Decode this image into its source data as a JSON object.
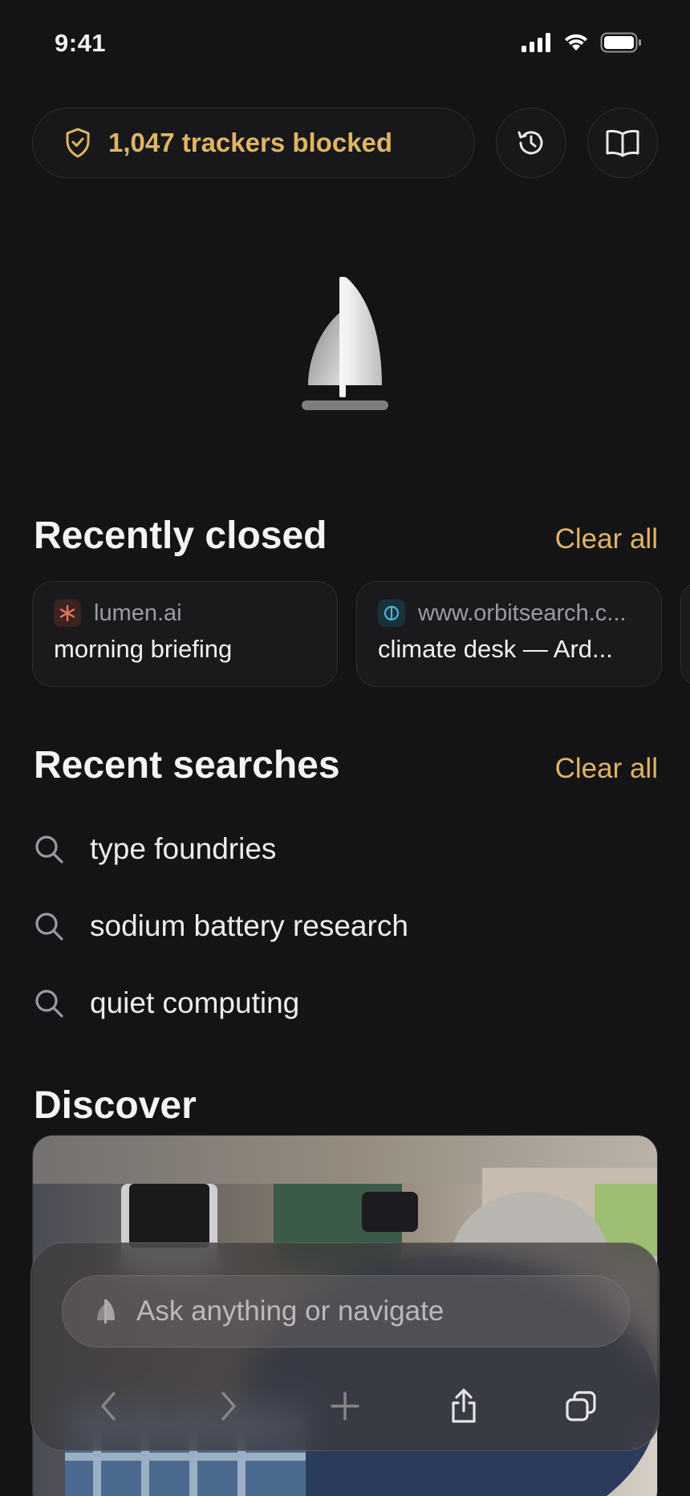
{
  "status": {
    "time": "9:41"
  },
  "header": {
    "trackers_label": "1,047 trackers blocked",
    "history_icon": "history-icon",
    "reader_icon": "book-icon"
  },
  "recently_closed": {
    "title": "Recently closed",
    "clear_label": "Clear all",
    "tabs": [
      {
        "site": "lumen.ai",
        "title": "morning briefing",
        "favicon": "asterisk-icon",
        "favicon_color": "#e8765a"
      },
      {
        "site": "www.orbitsearch.c...",
        "title": "climate desk — Ard...",
        "favicon": "orbit-icon",
        "favicon_color": "#4fb3d9"
      }
    ]
  },
  "recent_searches": {
    "title": "Recent searches",
    "clear_label": "Clear all",
    "items": [
      "type foundries",
      "sodium battery research",
      "quiet computing"
    ]
  },
  "discover": {
    "title": "Discover"
  },
  "omnibox": {
    "placeholder": "Ask anything or navigate"
  },
  "toolbar": {
    "buttons": [
      "back-icon",
      "forward-icon",
      "new-tab-icon",
      "share-icon",
      "tabs-icon"
    ]
  },
  "colors": {
    "accent": "#e0b461",
    "background": "#141416"
  }
}
